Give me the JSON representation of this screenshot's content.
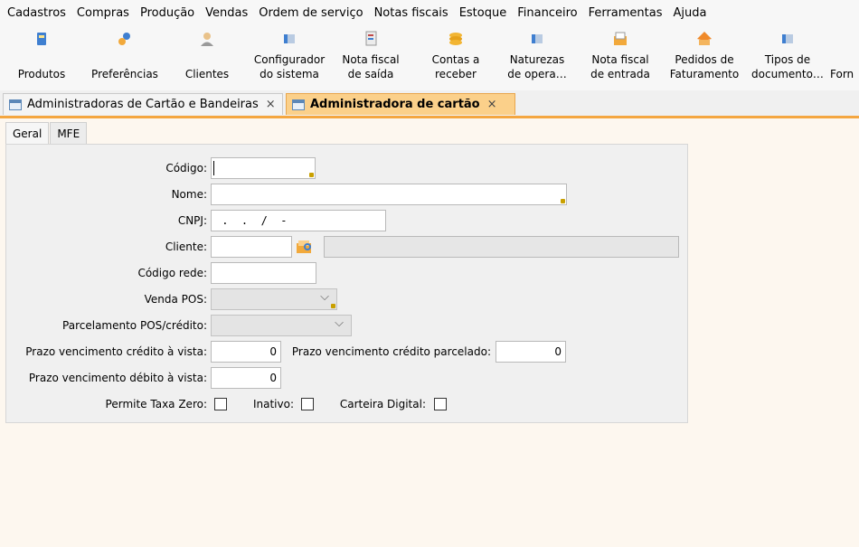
{
  "menu": [
    "Cadastros",
    "Compras",
    "Produção",
    "Vendas",
    "Ordem de serviço",
    "Notas fiscais",
    "Estoque",
    "Financeiro",
    "Ferramentas",
    "Ajuda"
  ],
  "toolbar": [
    {
      "label1": "",
      "label2": "Produtos",
      "icon": "products-icon"
    },
    {
      "label1": "",
      "label2": "Preferências",
      "icon": "preferences-icon"
    },
    {
      "label1": "",
      "label2": "Clientes",
      "icon": "clients-icon"
    },
    {
      "label1": "Configurador",
      "label2": "do sistema",
      "icon": "config-icon"
    },
    {
      "label1": "Nota fiscal",
      "label2": "de saída",
      "icon": "invoice-out-icon"
    },
    {
      "label1": "Contas a",
      "label2": "receber",
      "icon": "receivables-icon"
    },
    {
      "label1": "Naturezas",
      "label2": "de opera…",
      "icon": "operations-icon"
    },
    {
      "label1": "Nota fiscal",
      "label2": "de entrada",
      "icon": "invoice-in-icon"
    },
    {
      "label1": "Pedidos de",
      "label2": "Faturamento",
      "icon": "orders-icon"
    },
    {
      "label1": "Tipos de",
      "label2": "documento…",
      "icon": "doc-types-icon"
    },
    {
      "label1": "",
      "label2": "Forn",
      "icon": "suppliers-icon"
    }
  ],
  "tabs": [
    {
      "label": "Administradoras de Cartão e Bandeiras",
      "close": "×"
    },
    {
      "label": "Administradora de cartão",
      "close": "×"
    }
  ],
  "subtabs": [
    "Geral",
    "MFE"
  ],
  "form": {
    "codigo_label": "Código:",
    "nome_label": "Nome:",
    "cnpj_label": "CNPJ:",
    "cnpj_value": " .  .  /  -",
    "cliente_label": "Cliente:",
    "codigo_rede_label": "Código rede:",
    "venda_pos_label": "Venda POS:",
    "parcelamento_label": "Parcelamento POS/crédito:",
    "prazo_credito_vista_label": "Prazo vencimento crédito à vista:",
    "prazo_credito_vista_value": "0",
    "prazo_credito_parcelado_label": "Prazo vencimento crédito parcelado:",
    "prazo_credito_parcelado_value": "0",
    "prazo_debito_vista_label": "Prazo vencimento débito à vista:",
    "prazo_debito_vista_value": "0",
    "permite_taxa_zero_label": "Permite Taxa Zero:",
    "inativo_label": "Inativo:",
    "carteira_digital_label": "Carteira Digital:",
    "chevron": "⌵"
  },
  "colors": {
    "accent": "#f4a640",
    "active_tab": "#fbd08a"
  }
}
